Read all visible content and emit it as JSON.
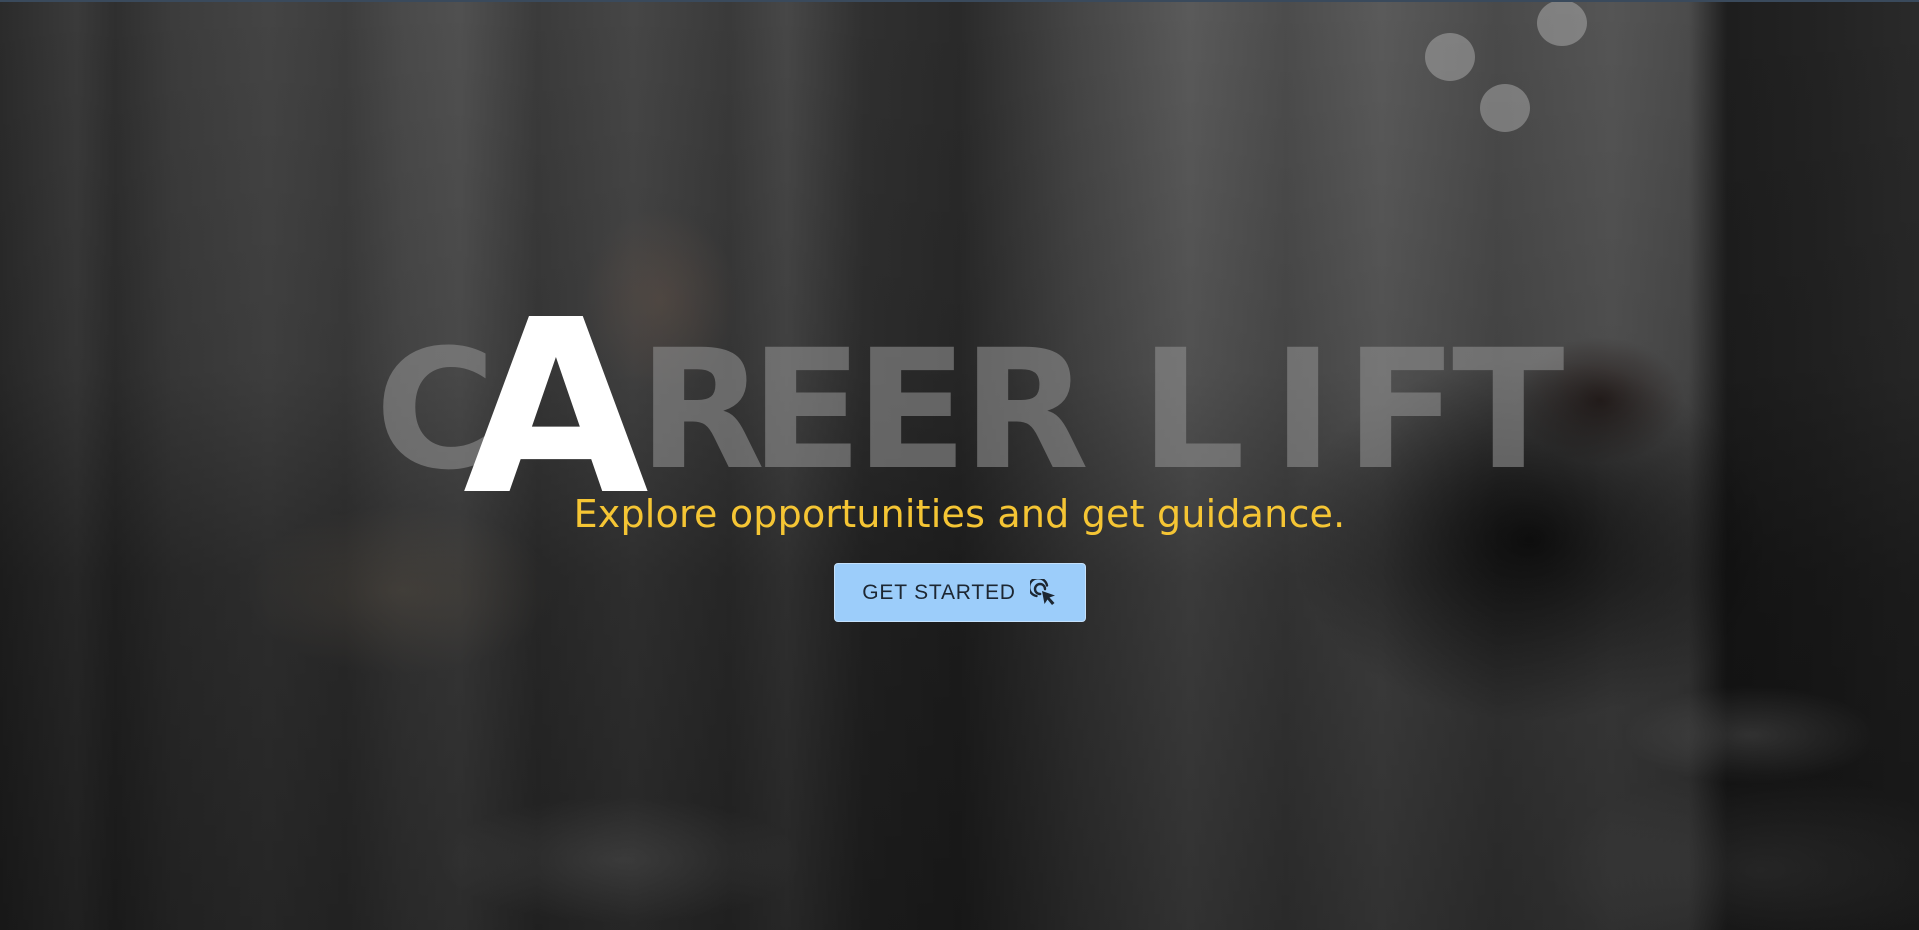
{
  "hero": {
    "logo": {
      "letters": [
        "C",
        "A",
        "R",
        "E",
        "E",
        "R",
        "L",
        "I",
        "F",
        "T"
      ],
      "highlighted_letter": "A"
    },
    "tagline": "Explore opportunities and get guidance.",
    "cta": {
      "label": "GET STARTED",
      "icon": "cursor-click-icon"
    }
  },
  "colors": {
    "tagline": "#f5c534",
    "cta_background": "#9ccdfa",
    "cta_text": "#1d2732",
    "logo_dim": "#8c8c8c",
    "logo_highlight": "#ffffff"
  }
}
